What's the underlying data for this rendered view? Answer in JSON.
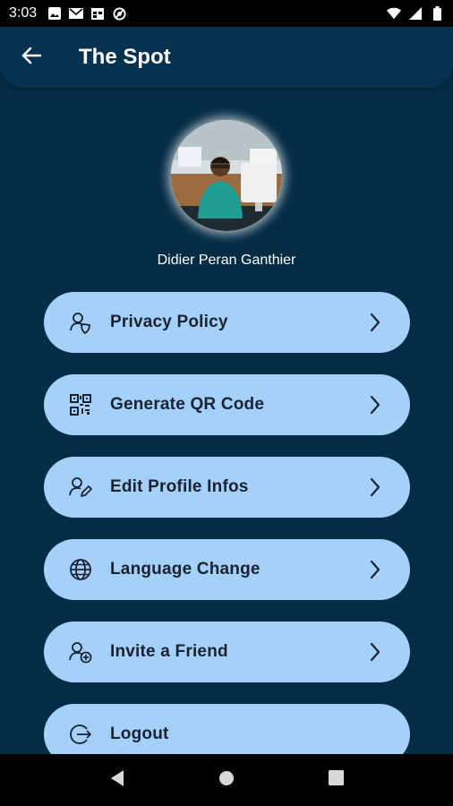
{
  "status_bar": {
    "time": "3:03",
    "left_icons": [
      "image-icon",
      "gmail-icon",
      "calendar-icon",
      "no-disturb-icon"
    ],
    "right_icons": [
      "wifi-icon",
      "signal-icon",
      "battery-icon"
    ]
  },
  "app_bar": {
    "title": "The Spot",
    "back_icon": "arrow-left-icon"
  },
  "profile": {
    "name": "Didier Peran Ganthier"
  },
  "menu": [
    {
      "label": "Privacy Policy",
      "icon": "privacy-user-icon"
    },
    {
      "label": "Generate QR Code",
      "icon": "qr-code-icon"
    },
    {
      "label": "Edit Profile Infos",
      "icon": "edit-profile-icon"
    },
    {
      "label": "Language Change",
      "icon": "globe-icon"
    },
    {
      "label": "Invite a Friend",
      "icon": "add-user-icon"
    },
    {
      "label": "Logout",
      "icon": "logout-icon"
    }
  ],
  "colors": {
    "background": "#052c45",
    "app_bar": "#063250",
    "menu_item": "#a3d1fa",
    "menu_text": "#1c2230"
  },
  "nav_bar": [
    "back-triangle-icon",
    "home-circle-icon",
    "recents-square-icon"
  ]
}
